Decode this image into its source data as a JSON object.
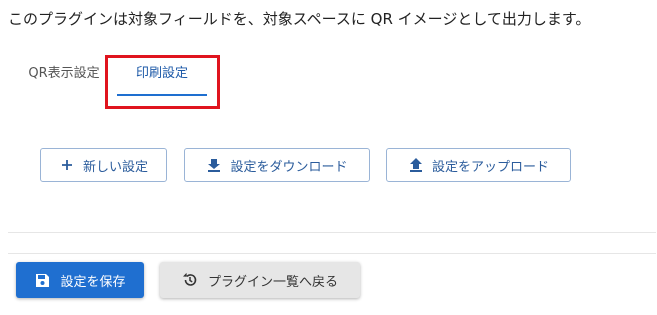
{
  "intro_text": "このプラグインは対象フィールドを、対象スペースに QR イメージとして出力します。",
  "tabs": [
    {
      "label": "QR表示設定",
      "active": false
    },
    {
      "label": "印刷設定",
      "active": true
    }
  ],
  "actions": {
    "new_label": "新しい設定",
    "download_label": "設定をダウンロード",
    "upload_label": "設定をアップロード"
  },
  "footer": {
    "save_label": "設定を保存",
    "back_label": "プラグイン一覧へ戻る"
  },
  "colors": {
    "accent": "#1f6fd0",
    "highlight": "#e0141e",
    "outline_text": "#2b5c9c"
  },
  "icons": {
    "new": "plus-icon",
    "download": "download-icon",
    "upload": "upload-icon",
    "save": "floppy-disk-icon",
    "back": "history-back-icon"
  }
}
